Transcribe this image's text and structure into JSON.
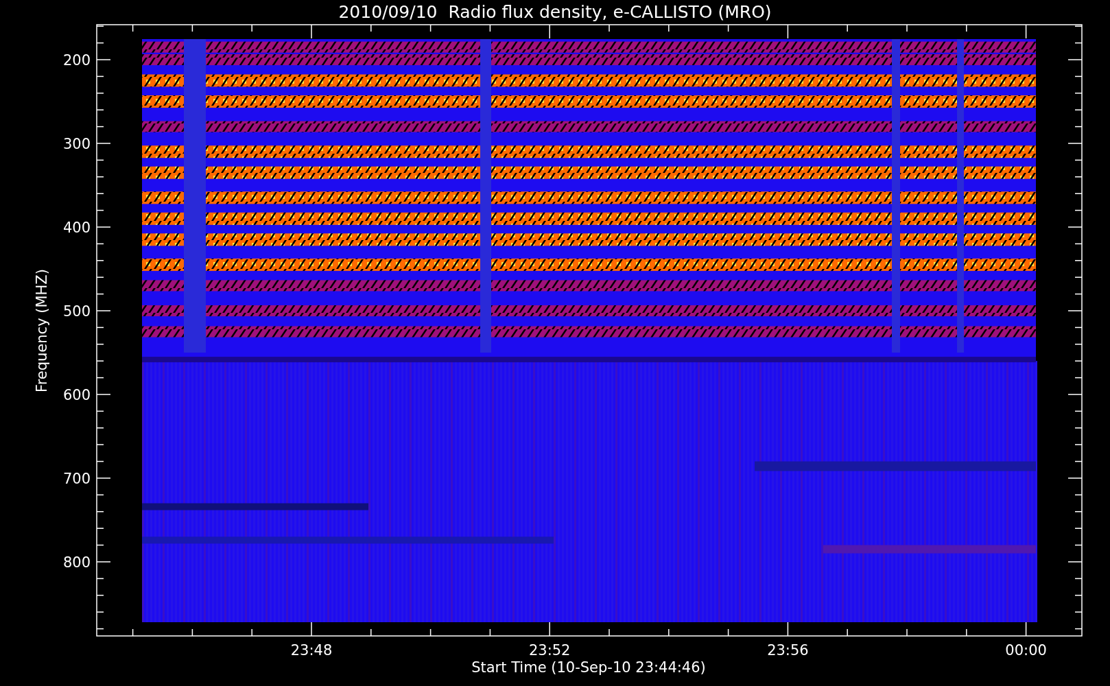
{
  "title": "2010/09/10  Radio flux density, e-CALLISTO (MRO)",
  "y_axis": {
    "label": "Frequency (MHZ)",
    "ticks": [
      "200",
      "300",
      "400",
      "500",
      "600",
      "700",
      "800"
    ]
  },
  "x_axis": {
    "label": "Start Time (10-Sep-10 23:44:46)",
    "ticks": [
      "23:48",
      "23:52",
      "23:56",
      "00:00"
    ]
  }
}
